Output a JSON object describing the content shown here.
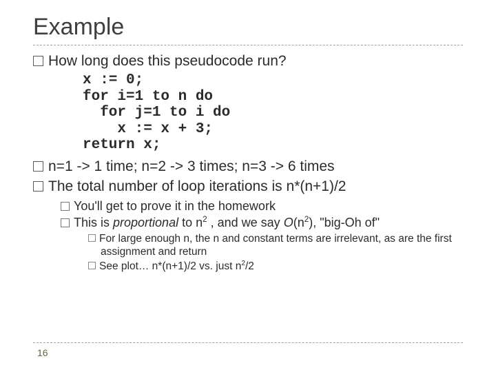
{
  "title": "Example",
  "bullet1": "How long does this pseudocode run?",
  "code": "x := 0;\nfor i=1 to n do\n  for j=1 to i do\n    x := x + 3;\nreturn x;",
  "bullet2_pre": "n=1 -> 1 time; n=2 -> 3 times; n=3 -> 6 times",
  "bullet3": "The total number of loop iterations is n*(n+1)/2",
  "sub1": "You'll get to prove it in the homework",
  "sub2_a": "This is ",
  "sub2_b": "proportional",
  "sub2_c": " to n",
  "sub2_d": " , and we say ",
  "sub2_e": "O",
  "sub2_f": "(n",
  "sub2_g": "), \"big-Oh of\"",
  "subsub1": "For large enough n, the n and constant terms are irrelevant, as are the first assignment and return",
  "subsub2_a": "See plot… n*(n+1)/2 vs. just n",
  "subsub2_b": "/2",
  "exp2": "2",
  "page": "16"
}
